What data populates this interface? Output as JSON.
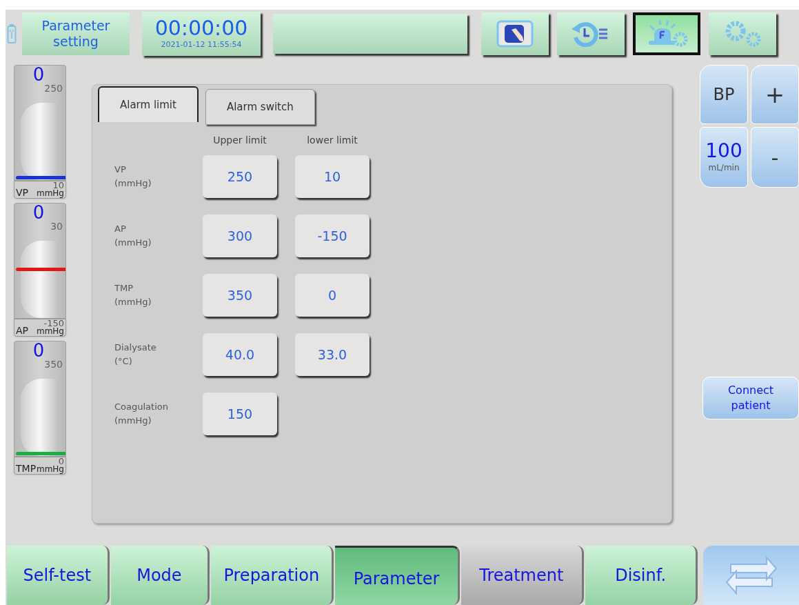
{
  "header": {
    "title": "Parameter setting",
    "timer": "00:00:00",
    "datetime": "2021-01-12 11:55:54"
  },
  "toolbar": [
    {
      "kind": "hand",
      "selected": false
    },
    {
      "kind": "history",
      "selected": false
    },
    {
      "kind": "alarm",
      "selected": true
    },
    {
      "kind": "settings",
      "selected": false
    }
  ],
  "gauges": [
    {
      "value": "0",
      "max": "250",
      "min": "10",
      "name": "VP",
      "unit": "mmHg",
      "color": "#1a33d6",
      "level": 0.0
    },
    {
      "value": "0",
      "max": "30",
      "min": "-150",
      "name": "AP",
      "unit": "mmHg",
      "color": "#e01818",
      "level": 0.45
    },
    {
      "value": "0",
      "max": "350",
      "min": "0",
      "name": "TMP",
      "unit": "mmHg",
      "color": "#19b040",
      "level": 0.0
    }
  ],
  "panel_tabs": [
    {
      "label": "Alarm limit",
      "selected": true
    },
    {
      "label": "Alarm switch",
      "selected": false
    }
  ],
  "columns": [
    "Upper limit",
    "lower limit"
  ],
  "rows": [
    {
      "name": "VP",
      "unit": "(mmHg)",
      "upper": "250",
      "lower": "10"
    },
    {
      "name": "AP",
      "unit": "(mmHg)",
      "upper": "300",
      "lower": "-150"
    },
    {
      "name": "TMP",
      "unit": "(mmHg)",
      "upper": "350",
      "lower": "0"
    },
    {
      "name": "Dialysate",
      "unit": "(°C)",
      "upper": "40.0",
      "lower": "33.0"
    },
    {
      "name": "Coagulation",
      "unit": "(mmHg)",
      "upper": "150"
    }
  ],
  "pump": {
    "label": "BP",
    "plus": "+",
    "value": "100",
    "unit": "mL/min",
    "minus": "-"
  },
  "connect_button": "Connect patient",
  "nav_tabs": [
    {
      "label": "Self-test",
      "selected": false,
      "disabled": false
    },
    {
      "label": "Mode",
      "selected": false,
      "disabled": false
    },
    {
      "label": "Preparation",
      "selected": false,
      "disabled": false
    },
    {
      "label": "Parameter",
      "selected": true,
      "disabled": false
    },
    {
      "label": "Treatment",
      "selected": false,
      "disabled": true
    },
    {
      "label": "Disinf.",
      "selected": false,
      "disabled": false
    }
  ]
}
